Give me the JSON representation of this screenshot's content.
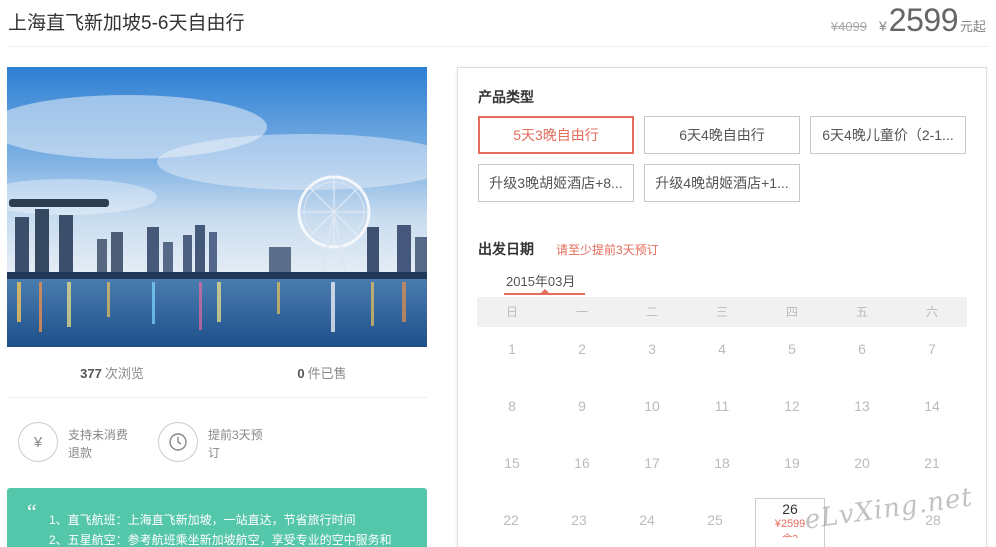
{
  "header": {
    "title": "上海直飞新加坡5-6天自由行",
    "old_price": "¥4099",
    "currency": "¥",
    "price": "2599",
    "price_unit": "元起"
  },
  "stats": {
    "views_count": "377",
    "views_label": "次浏览",
    "sold_count": "0",
    "sold_label": "件已售"
  },
  "features": [
    {
      "icon": "yen-refund-icon",
      "text": "支持未消费退款"
    },
    {
      "icon": "clock-back-icon",
      "text": "提前3天预订"
    }
  ],
  "highlights": {
    "lines": [
      "1、直飞航班：上海直飞新加坡，一站直达，节省旅行时间",
      "2、五星航空：参考航班乘坐新加坡航空，享受专业的空中服务和"
    ]
  },
  "product_type": {
    "title": "产品类型",
    "options": [
      {
        "label": "5天3晚自由行",
        "selected": true
      },
      {
        "label": "6天4晚自由行",
        "selected": false
      },
      {
        "label": "6天4晚儿童价（2-1...",
        "selected": false
      },
      {
        "label": "升级3晚胡姬酒店+8...",
        "selected": false
      },
      {
        "label": "升级4晚胡姬酒店+1...",
        "selected": false
      }
    ]
  },
  "departure": {
    "title": "出发日期",
    "hint": "请至少提前3天预订",
    "month": "2015年03月",
    "weekdays": [
      "日",
      "一",
      "二",
      "三",
      "四",
      "五",
      "六"
    ],
    "rows": [
      [
        "1",
        "2",
        "3",
        "4",
        "5",
        "6",
        "7"
      ],
      [
        "8",
        "9",
        "10",
        "11",
        "12",
        "13",
        "14"
      ],
      [
        "15",
        "16",
        "17",
        "18",
        "19",
        "20",
        "21"
      ],
      [
        "22",
        "23",
        "24",
        "25",
        "26",
        "27",
        "28"
      ]
    ],
    "available": {
      "day": "26",
      "price": "¥2599",
      "note": "余?"
    }
  },
  "watermark": "eLvXing.net",
  "colors": {
    "accent": "#e36c5b",
    "green": "#54c6a9"
  }
}
